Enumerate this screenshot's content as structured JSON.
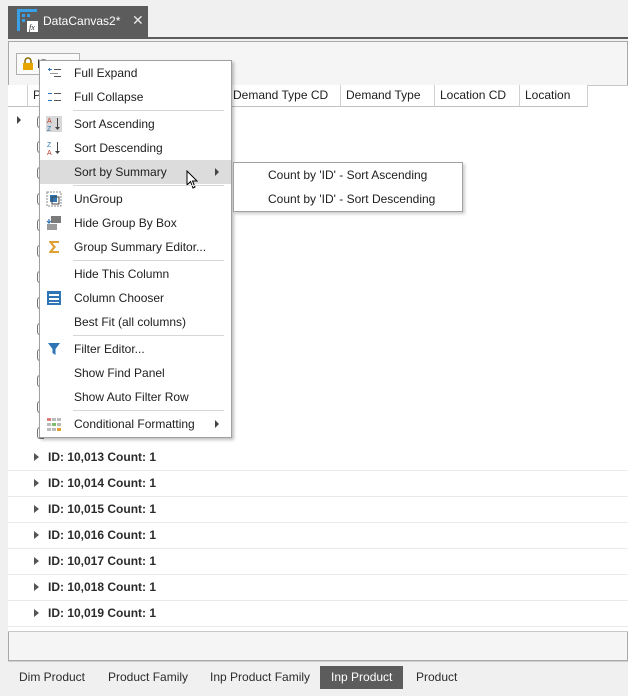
{
  "document_tab": {
    "title": "DataCanvas2*",
    "close": "✕",
    "icon": "datacanvas-fx-icon"
  },
  "group_panel": {
    "button_text": "ID",
    "icon": "lock-icon"
  },
  "grid": {
    "columns": [
      {
        "label": "P"
      },
      {
        "label": "Demand Type CD"
      },
      {
        "label": "Demand Type"
      },
      {
        "label": "Location CD"
      },
      {
        "label": "Location"
      }
    ],
    "group_rows": [
      "ID: 10,013 Count: 1",
      "ID: 10,014 Count: 1",
      "ID: 10,015 Count: 1",
      "ID: 10,016 Count: 1",
      "ID: 10,017 Count: 1",
      "ID: 10,018 Count: 1",
      "ID: 10,019 Count: 1"
    ]
  },
  "context_menu": {
    "items": [
      {
        "label": "Full Expand",
        "icon": "full-expand-icon"
      },
      {
        "label": "Full Collapse",
        "icon": "full-collapse-icon"
      },
      {
        "label": "Sort Ascending",
        "icon": "sort-ascending-icon"
      },
      {
        "label": "Sort Descending",
        "icon": "sort-descending-icon"
      },
      {
        "label": "Sort by Summary",
        "icon": "",
        "submenu": true
      },
      {
        "label": "UnGroup",
        "icon": "ungroup-icon"
      },
      {
        "label": "Hide Group By Box",
        "icon": "hide-group-box-icon"
      },
      {
        "label": "Group Summary Editor...",
        "icon": "sigma-icon"
      },
      {
        "label": "Hide This Column",
        "icon": ""
      },
      {
        "label": "Column Chooser",
        "icon": "column-chooser-icon"
      },
      {
        "label": "Best Fit (all columns)",
        "icon": ""
      },
      {
        "label": "Filter Editor...",
        "icon": "filter-icon"
      },
      {
        "label": "Show Find Panel",
        "icon": ""
      },
      {
        "label": "Show Auto Filter Row",
        "icon": ""
      },
      {
        "label": "Conditional Formatting",
        "icon": "conditional-formatting-icon",
        "submenu": true
      }
    ]
  },
  "submenu": {
    "items": [
      {
        "label": "Count by 'ID' - Sort Ascending"
      },
      {
        "label": "Count by 'ID' - Sort Descending"
      }
    ]
  },
  "bottom_tabs": [
    {
      "label": "Dim Product",
      "active": false
    },
    {
      "label": "Product Family",
      "active": false
    },
    {
      "label": "Inp Product Family",
      "active": false
    },
    {
      "label": "Inp Product",
      "active": true
    },
    {
      "label": "Product",
      "active": false
    }
  ],
  "colors": {
    "tab_active_bg": "#5c5c5c",
    "menu_highlight": "#dcdcdc",
    "filter_icon": "#2e75b6",
    "sigma_icon": "#e0a030"
  }
}
